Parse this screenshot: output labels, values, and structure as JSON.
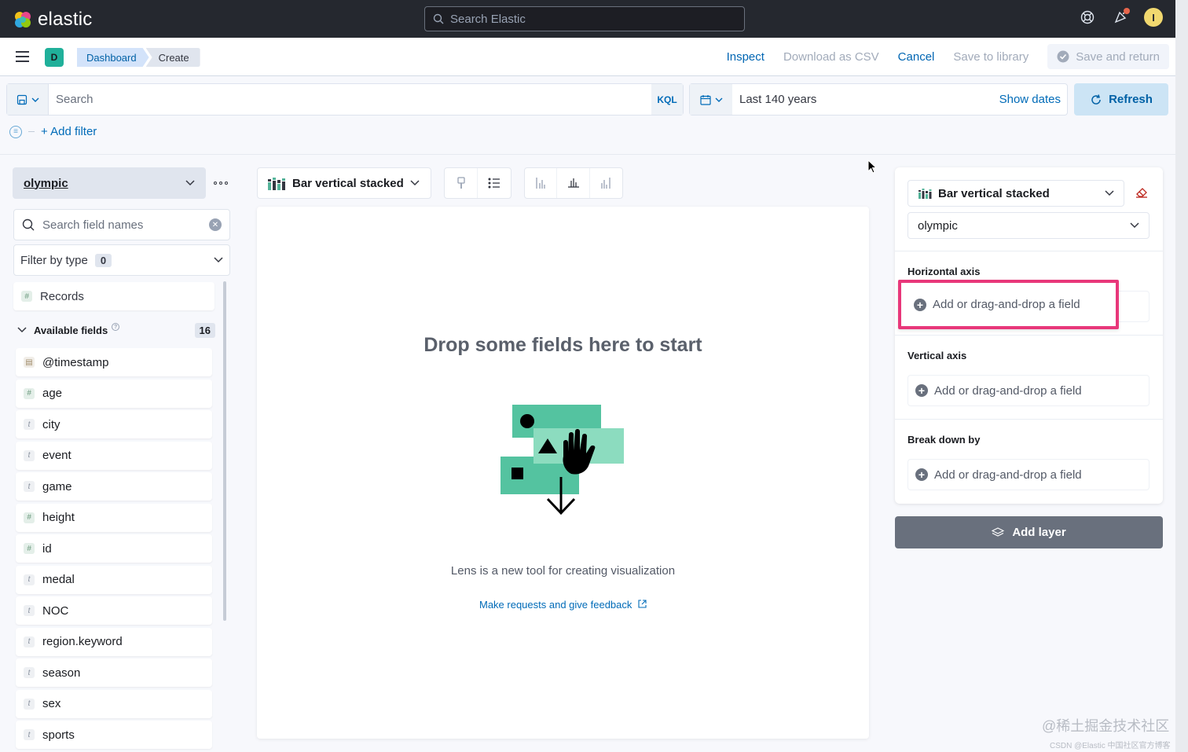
{
  "header": {
    "logo_text": "elastic",
    "search_placeholder": "Search Elastic",
    "avatar_initial": "I"
  },
  "appbar": {
    "space_initial": "D",
    "breadcrumbs": [
      "Dashboard",
      "Create"
    ],
    "actions": {
      "inspect": "Inspect",
      "download_csv": "Download as CSV",
      "cancel": "Cancel",
      "save_library": "Save to library",
      "save_return": "Save and return"
    }
  },
  "query": {
    "search_placeholder": "Search",
    "language": "KQL",
    "time_range": "Last 140 years",
    "show_dates": "Show dates",
    "refresh": "Refresh",
    "add_filter": "+ Add filter"
  },
  "fields_panel": {
    "index_pattern": "olympic",
    "search_placeholder": "Search field names",
    "filter_by_type": "Filter by type",
    "filter_count": "0",
    "records_label": "Records",
    "available_label": "Available fields",
    "available_count": "16",
    "fields": [
      {
        "name": "@timestamp",
        "type": "date",
        "icon": "calendar-icon"
      },
      {
        "name": "age",
        "type": "number",
        "icon": "#"
      },
      {
        "name": "city",
        "type": "string",
        "icon": "t"
      },
      {
        "name": "event",
        "type": "string",
        "icon": "t"
      },
      {
        "name": "game",
        "type": "string",
        "icon": "t"
      },
      {
        "name": "height",
        "type": "number",
        "icon": "#"
      },
      {
        "name": "id",
        "type": "number",
        "icon": "#"
      },
      {
        "name": "medal",
        "type": "string",
        "icon": "t"
      },
      {
        "name": "NOC",
        "type": "string",
        "icon": "t"
      },
      {
        "name": "region.keyword",
        "type": "string",
        "icon": "t"
      },
      {
        "name": "season",
        "type": "string",
        "icon": "t"
      },
      {
        "name": "sex",
        "type": "string",
        "icon": "t"
      },
      {
        "name": "sports",
        "type": "string",
        "icon": "t"
      }
    ]
  },
  "workspace": {
    "chart_type": "Bar vertical stacked",
    "drop_title": "Drop some fields here to start",
    "lens_note": "Lens is a new tool for creating visualization",
    "feedback_link": "Make requests and give feedback"
  },
  "config": {
    "chart_type": "Bar vertical stacked",
    "index_pattern": "olympic",
    "horizontal_axis": "Horizontal axis",
    "vertical_axis": "Vertical axis",
    "break_down": "Break down by",
    "slot_text": "Add or drag-and-drop a field",
    "add_layer": "Add layer"
  },
  "watermark": {
    "main": "@稀土掘金技术社区",
    "sub": "CSDN @Elastic 中国社区官方博客"
  },
  "colors": {
    "accent": "#0066b3",
    "highlight_border": "#e8377a",
    "illustration_green": "#54c3a0"
  }
}
